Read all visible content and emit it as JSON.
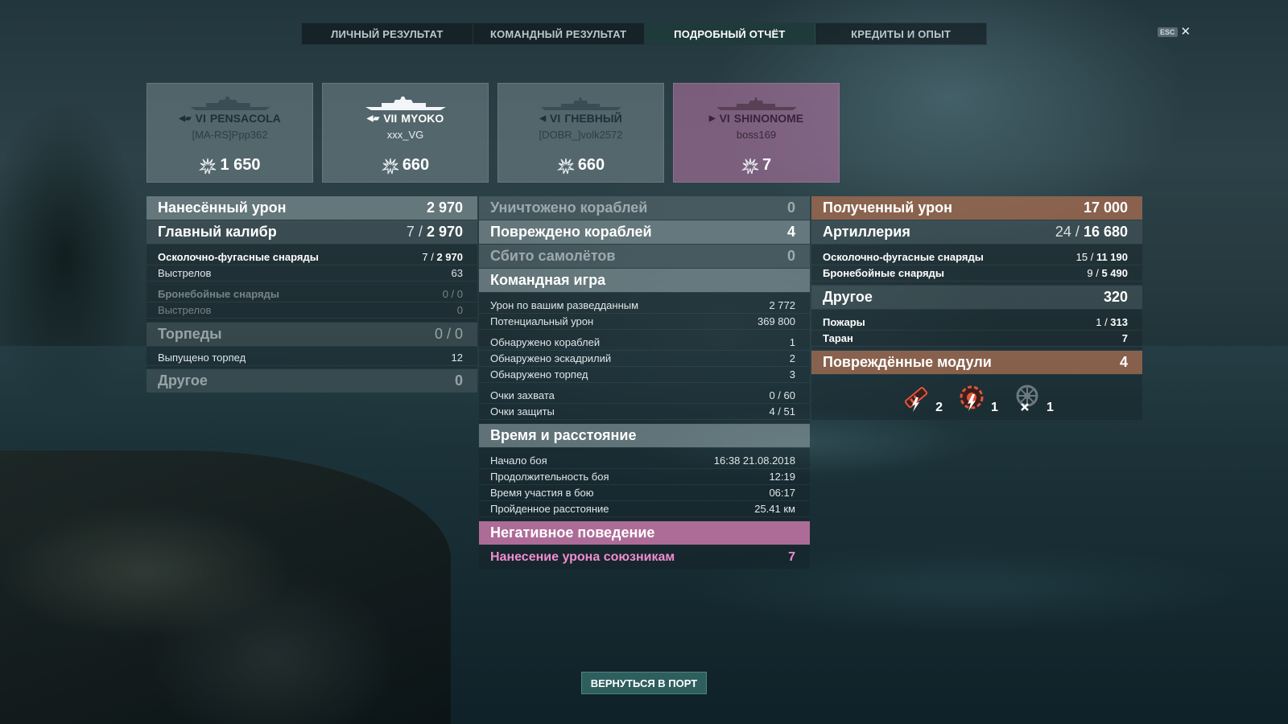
{
  "tabs": [
    {
      "label": "ЛИЧНЫЙ РЕЗУЛЬТАТ"
    },
    {
      "label": "КОМАНДНЫЙ РЕЗУЛЬТАТ"
    },
    {
      "label": "ПОДРОБНЫЙ ОТЧЁТ",
      "active": true
    },
    {
      "label": "КРЕДИТЫ И ОПЫТ"
    }
  ],
  "esc": {
    "key": "ESC",
    "close": "✕"
  },
  "cards": [
    {
      "tier": "VI",
      "ship": "PENSACOLA",
      "player": "[MA-RS]Ppp362",
      "score": "1 650",
      "icon": "cruiser-icon"
    },
    {
      "tier": "VII",
      "ship": "MYOKO",
      "player": "xxx_VG",
      "score": "660",
      "icon": "cruiser-icon"
    },
    {
      "tier": "VI",
      "ship": "ГНЕВНЫЙ",
      "player": "[DOBR_]volk2572",
      "score": "660",
      "icon": "destroyer-icon"
    },
    {
      "tier": "VI",
      "ship": "SHINONOME",
      "player": "boss169",
      "score": "7",
      "icon": "destroyer-icon"
    }
  ],
  "left": {
    "damage": {
      "label": "Нанесённый урон",
      "value": "2 970"
    },
    "main_battery": {
      "label": "Главный калибр",
      "hits": "7",
      "value": "2 970"
    },
    "he": {
      "label": "Осколочно-фугасные снаряды",
      "hits": "7",
      "value": "2 970"
    },
    "he_shots": {
      "label": "Выстрелов",
      "value": "63"
    },
    "ap": {
      "label": "Бронебойные снаряды",
      "value": "0 / 0"
    },
    "ap_shots": {
      "label": "Выстрелов",
      "value": "0"
    },
    "torpedoes": {
      "label": "Торпеды",
      "value": "0 / 0"
    },
    "torp_launched": {
      "label": "Выпущено торпед",
      "value": "12"
    },
    "other": {
      "label": "Другое",
      "value": "0"
    }
  },
  "middle": {
    "destroyed": {
      "label": "Уничтожено кораблей",
      "value": "0"
    },
    "damaged": {
      "label": "Повреждено кораблей",
      "value": "4"
    },
    "planes": {
      "label": "Сбито самолётов",
      "value": "0"
    },
    "teamplay": {
      "label": "Командная игра"
    },
    "spotting_dmg": {
      "label": "Урон по вашим разведданным",
      "value": "2 772"
    },
    "potential_dmg": {
      "label": "Потенциальный урон",
      "value": "369 800"
    },
    "spotted_ships": {
      "label": "Обнаружено кораблей",
      "value": "1"
    },
    "spotted_squadrons": {
      "label": "Обнаружено эскадрилий",
      "value": "2"
    },
    "spotted_torps": {
      "label": "Обнаружено торпед",
      "value": "3"
    },
    "capture": {
      "label": "Очки захвата",
      "value": "0 / 60"
    },
    "defense": {
      "label": "Очки защиты",
      "value": "4 / 51"
    },
    "time": {
      "label": "Время и расстояние"
    },
    "start": {
      "label": "Начало боя",
      "value": "16:38  21.08.2018"
    },
    "duration": {
      "label": "Продолжительность боя",
      "value": "12:19"
    },
    "participation": {
      "label": "Время участия в бою",
      "value": "06:17"
    },
    "distance": {
      "label": "Пройденное расстояние",
      "value": "25.41 км"
    },
    "negative": {
      "label": "Негативное поведение"
    },
    "teamdamage": {
      "label": "Нанесение урона союзникам",
      "value": "7"
    }
  },
  "right": {
    "received": {
      "label": "Полученный урон",
      "value": "17 000"
    },
    "artillery": {
      "label": "Артиллерия",
      "hits": "24",
      "value": "16 680"
    },
    "he": {
      "label": "Осколочно-фугасные снаряды",
      "hits": "15",
      "value": "11 190"
    },
    "ap": {
      "label": "Бронебойные снаряды",
      "hits": "9",
      "value": "5 490"
    },
    "other": {
      "label": "Другое",
      "value": "320"
    },
    "fires": {
      "label": "Пожары",
      "hits": "1",
      "value": "313"
    },
    "ram": {
      "label": "Таран",
      "value": "7"
    },
    "modules": {
      "label": "Повреждённые модули",
      "value": "4"
    },
    "module_items": [
      {
        "icon": "gun-damaged-icon",
        "count": "2"
      },
      {
        "icon": "engine-damaged-icon",
        "count": "1"
      },
      {
        "icon": "steering-destroyed-icon",
        "count": "1"
      }
    ]
  },
  "back_button": "ВЕРНУТЬСЯ В ПОРТ"
}
